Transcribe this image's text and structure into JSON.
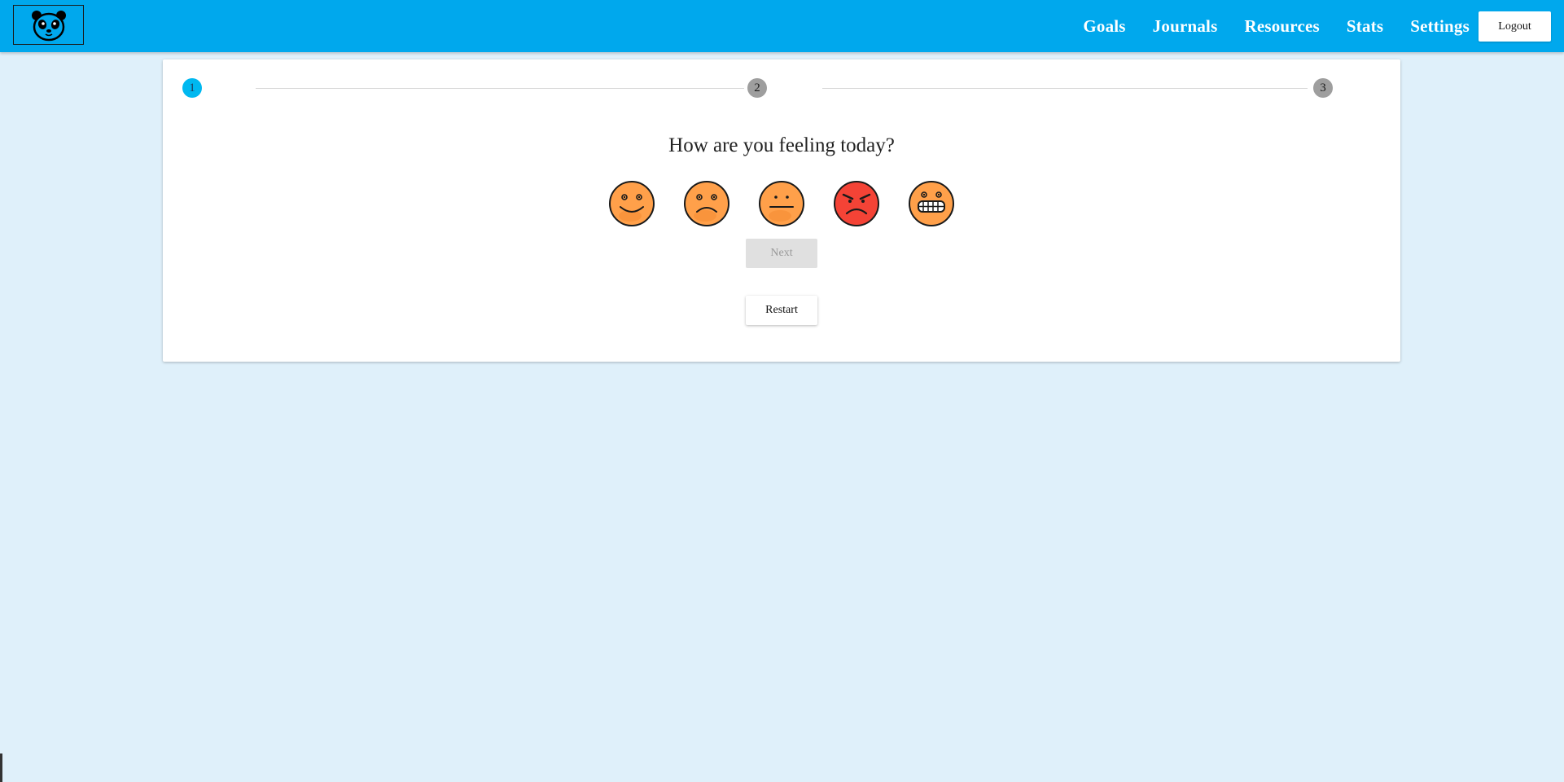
{
  "header": {
    "logo_icon": "panda-icon",
    "nav": [
      "Goals",
      "Journals",
      "Resources",
      "Stats",
      "Settings"
    ],
    "logout_label": "Logout",
    "background_color": "#00a8ed"
  },
  "stepper": {
    "steps": [
      "1",
      "2",
      "3"
    ],
    "active_step": 1,
    "active_color": "#00b8f0",
    "inactive_color": "#9e9e9e"
  },
  "mood": {
    "question": "How are you feeling today?",
    "options": [
      "happy-face-icon",
      "sad-face-icon",
      "neutral-face-icon",
      "angry-face-icon",
      "grimacing-face-icon"
    ]
  },
  "actions": {
    "next_label": "Next",
    "restart_label": "Restart"
  },
  "colors": {
    "page_background": "#dff0fa",
    "emoji_orange": "#ffa04a",
    "emoji_red": "#f44336"
  }
}
